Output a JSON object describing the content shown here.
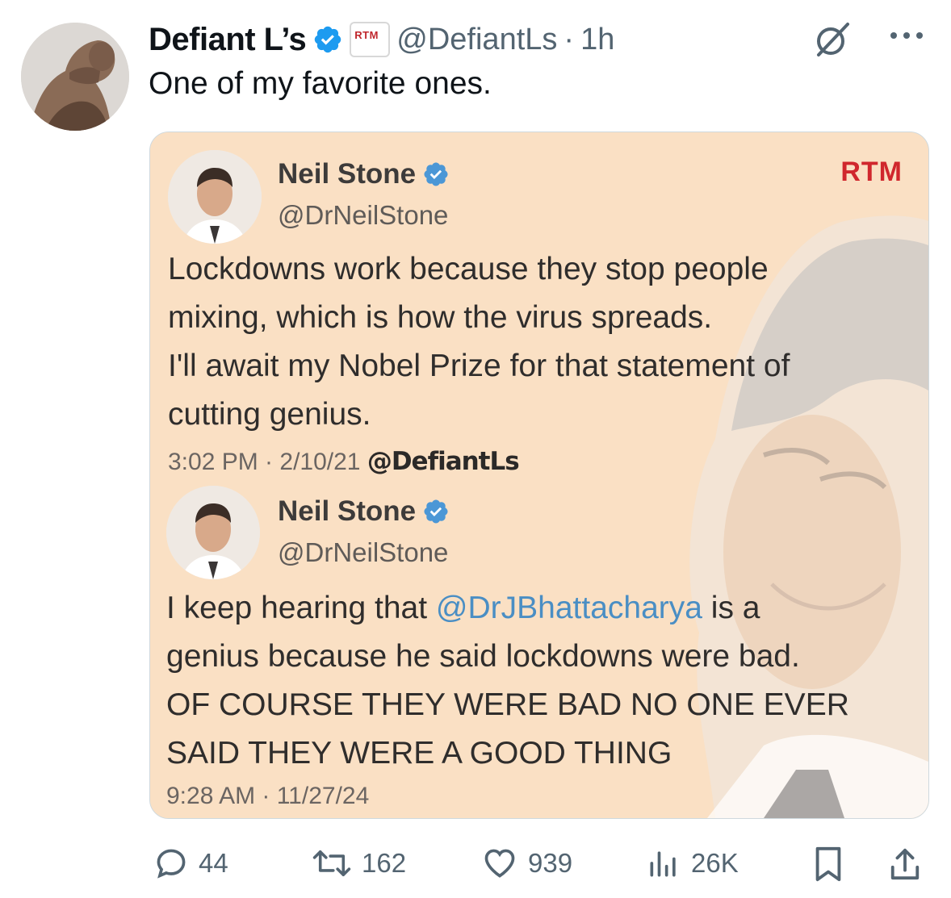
{
  "post": {
    "author_name": "Defiant L’s",
    "handle": "@DefiantLs",
    "separator": "·",
    "time": "1h",
    "text": "One of my favorite ones.",
    "affiliate_badge": "RTM"
  },
  "embedded_image": {
    "watermark": "RTM",
    "tweets": [
      {
        "name": "Neil Stone",
        "handle": "@DrNeilStone",
        "body": "Lockdowns work because they stop people\nmixing, which is how the virus spreads.\nI'll await my Nobel Prize for that statement of\ncutting genius.",
        "meta": "3:02 PM · 2/10/21",
        "credit": "@DefiantLs"
      },
      {
        "name": "Neil Stone",
        "handle": "@DrNeilStone",
        "body_prefix": "I keep hearing that ",
        "body_mention": "@DrJBhattacharya",
        "body_suffix": " is a\ngenius because he said lockdowns were bad.\nOF COURSE THEY WERE BAD NO ONE EVER\nSAID THEY WERE A GOOD THING",
        "meta": "9:28 AM · 11/27/24"
      }
    ]
  },
  "actions": {
    "replies": "44",
    "reposts": "162",
    "likes": "939",
    "views": "26K"
  },
  "colors": {
    "card_bg": "#fae0c4",
    "verified": "#1d9bf0",
    "rtm_red": "#d0272d",
    "mention": "#4a8ec4",
    "meta_gray": "#536471"
  }
}
